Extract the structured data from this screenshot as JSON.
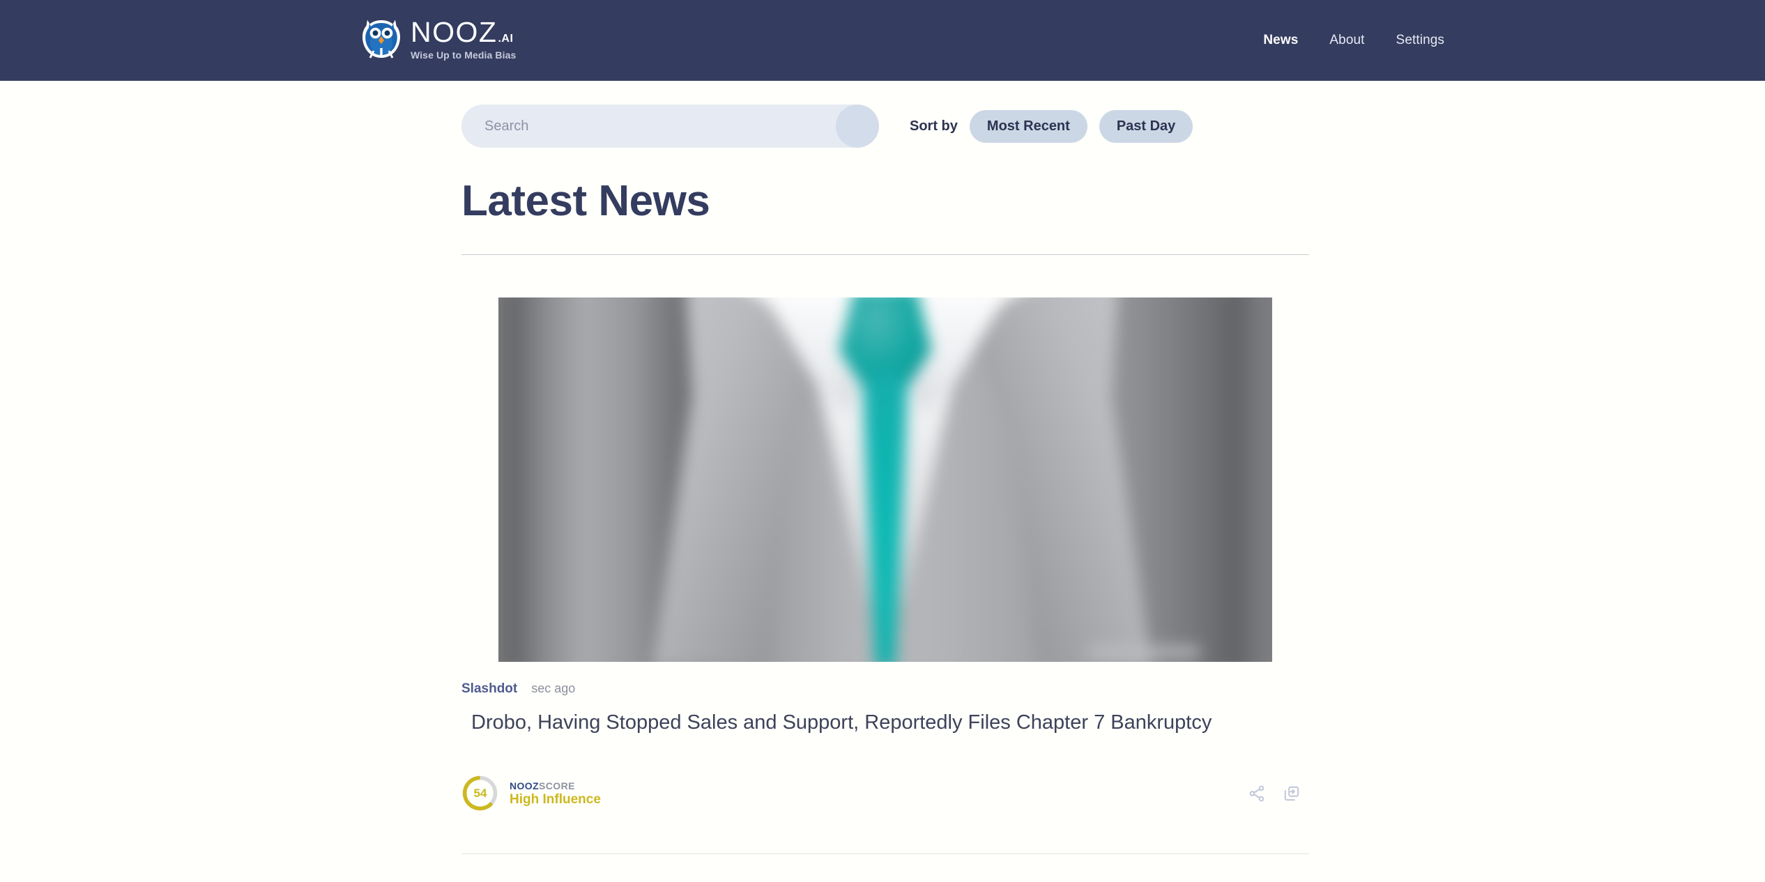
{
  "header": {
    "brand": {
      "logo_icon": "owl-icon",
      "name": "NOOZ",
      "suffix": ".AI",
      "tagline": "Wise Up to Media Bias"
    },
    "nav": [
      {
        "label": "News",
        "active": true
      },
      {
        "label": "About",
        "active": false
      },
      {
        "label": "Settings",
        "active": false
      }
    ],
    "background_color": "#343c5f"
  },
  "toolbar": {
    "search": {
      "placeholder": "Search",
      "value": "",
      "button_icon": "search-icon"
    },
    "sort_label": "Sort by",
    "sort_options": [
      {
        "label": "Most Recent"
      },
      {
        "label": "Past Day"
      }
    ]
  },
  "main": {
    "page_title": "Latest News",
    "articles": [
      {
        "source": "Slashdot",
        "timestamp": "sec ago",
        "headline": "Drobo, Having Stopped Sales and Support, Reportedly Files Chapter 7 Bankruptcy",
        "image_alt": "Blurred grayscale photo of a business suit with a teal necktie",
        "score": {
          "value": "54",
          "label_primary": "NOOZ",
          "label_secondary": "SCORE",
          "tier": "High Influence",
          "color": "#ccb81f",
          "track_color": "#d7d8da"
        },
        "actions": [
          {
            "icon": "share-icon"
          },
          {
            "icon": "copy-icon"
          }
        ]
      }
    ]
  },
  "colors": {
    "header_navy": "#343c5f",
    "page_background": "#fffffb",
    "chip_blue": "#ccd7e6",
    "search_field": "#e6eaf2",
    "score_gold": "#ccb81f",
    "tie_teal": "#0db9b4"
  }
}
